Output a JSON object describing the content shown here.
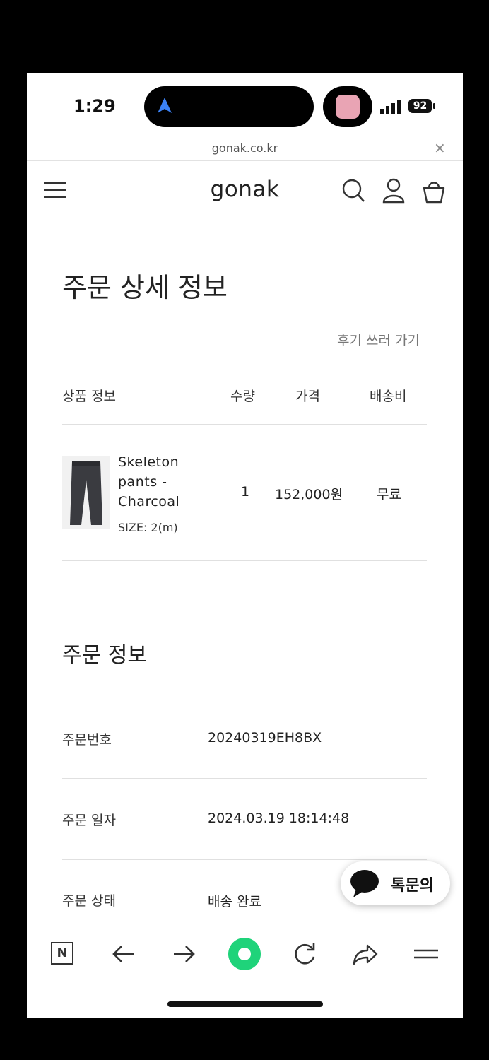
{
  "status": {
    "time": "1:29",
    "battery": "92"
  },
  "browser": {
    "url": "gonak.co.kr",
    "close": "×"
  },
  "header": {
    "logo": "gonak"
  },
  "page": {
    "title": "주문 상세 정보",
    "review_link": "후기 쓰러 가기"
  },
  "table": {
    "headers": [
      "상품 정보",
      "수량",
      "가격",
      "배송비"
    ],
    "rows": [
      {
        "name": "Skeleton pants - Charcoal",
        "size": "SIZE: 2(m)",
        "qty": "1",
        "price": "152,000원",
        "shipping": "무료"
      }
    ]
  },
  "order_info": {
    "title": "주문 정보",
    "rows": [
      {
        "label": "주문번호",
        "value": "20240319EH8BX"
      },
      {
        "label": "주문 일자",
        "value": "2024.03.19 18:14:48"
      },
      {
        "label": "주문 상태",
        "value": "배송 완료"
      }
    ]
  },
  "chat": {
    "label": "톡문의"
  },
  "toolbar": {
    "n_logo": "N"
  },
  "icons": [
    "location-arrow-icon",
    "signal-icon",
    "battery-icon",
    "menu-icon",
    "search-icon",
    "user-icon",
    "cart-icon",
    "chat-bubble-icon",
    "back-icon",
    "forward-icon",
    "refresh-icon",
    "share-icon",
    "more-menu-icon"
  ]
}
